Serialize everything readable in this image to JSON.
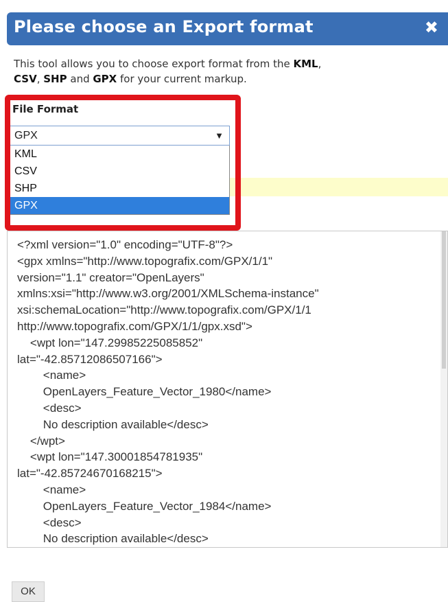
{
  "dialog": {
    "title": "Please choose an Export format",
    "close_glyph": "✖"
  },
  "intro": {
    "text1": "This tool allows you to choose export format from the ",
    "kml": "KML",
    "sep1": ",",
    "csv": "CSV",
    "sep2": ", ",
    "shp": "SHP",
    "and": " and ",
    "gpx": "GPX",
    "text2": " for your current markup."
  },
  "format": {
    "label": "File Format",
    "selected": "GPX",
    "arrow_glyph": "▼",
    "options": [
      "KML",
      "CSV",
      "SHP",
      "GPX"
    ]
  },
  "output": {
    "text": "<?xml version=\"1.0\" encoding=\"UTF-8\"?>\n<gpx xmlns=\"http://www.topografix.com/GPX/1/1\"\nversion=\"1.1\" creator=\"OpenLayers\"\nxmlns:xsi=\"http://www.w3.org/2001/XMLSchema-instance\"\nxsi:schemaLocation=\"http://www.topografix.com/GPX/1/1\nhttp://www.topografix.com/GPX/1/1/gpx.xsd\">\n    <wpt lon=\"147.29985225085852\"\nlat=\"-42.85712086507166\">\n        <name>\n        OpenLayers_Feature_Vector_1980</name>\n        <desc>\n        No description available</desc>\n    </wpt>\n    <wpt lon=\"147.30001854781935\"\nlat=\"-42.85724670168215\">\n        <name>\n        OpenLayers_Feature_Vector_1984</name>\n        <desc>\n        No description available</desc>"
  },
  "ok_label": "OK",
  "colors": {
    "title_bar": "#3a6fb5",
    "highlight": "#e0141b",
    "selected_option": "#2f7fdc",
    "notice_bar": "#fdfdcb"
  }
}
